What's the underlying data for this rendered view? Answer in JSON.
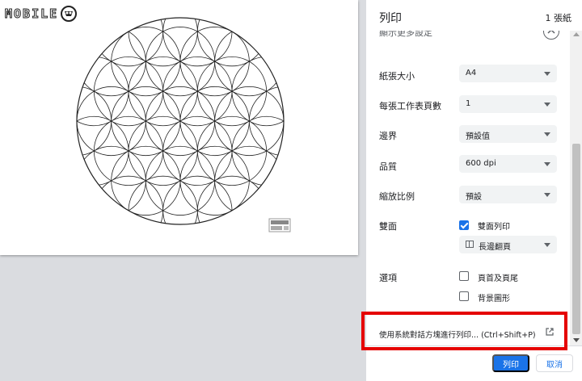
{
  "watermark": {
    "text": "MOBILE"
  },
  "header": {
    "title": "列印",
    "sheet_count": "1 張紙"
  },
  "settings": {
    "more_label": "顯示更多設定",
    "paper_size": {
      "label": "紙張大小",
      "value": "A4"
    },
    "pages_per_sheet": {
      "label": "每張工作表頁數",
      "value": "1"
    },
    "margins": {
      "label": "邊界",
      "value": "預設值"
    },
    "quality": {
      "label": "品質",
      "value": "600 dpi"
    },
    "scale": {
      "label": "縮放比例",
      "value": "預設"
    },
    "duplex": {
      "label": "雙面",
      "checkbox_label": "雙面列印",
      "checked": true,
      "flip_value": "長邊翻頁"
    },
    "options": {
      "label": "選項",
      "headers_footers": {
        "label": "頁首及頁尾",
        "checked": false
      },
      "background_graphics": {
        "label": "背景圖形",
        "checked": false
      }
    },
    "system_dialog": {
      "text": "使用系統對話方塊進行列印... (Ctrl+Shift+P)"
    }
  },
  "footer": {
    "print_label": "列印",
    "cancel_label": "取消"
  },
  "colors": {
    "accent": "#1a73e8",
    "highlight": "#e50000"
  },
  "icons": [
    "chevron-up-icon",
    "dropdown-arrow-icon",
    "duplex-page-icon",
    "external-link-icon",
    "checkbox-checked-icon"
  ]
}
